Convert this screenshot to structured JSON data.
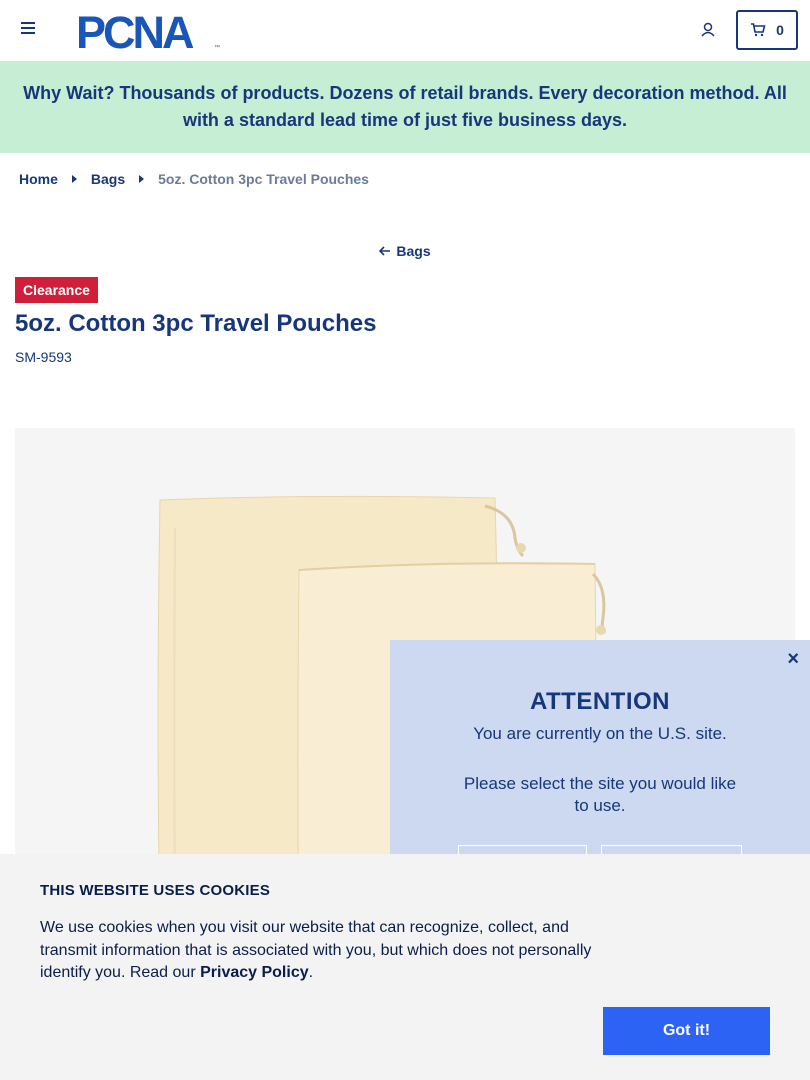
{
  "header": {
    "logo_text": "PCNA",
    "logo_mark": "™",
    "cart_count": "0"
  },
  "promo": {
    "text": "Why Wait? Thousands of products. Dozens of retail brands. Every decoration method. All with a standard lead time of just five business days."
  },
  "breadcrumb": [
    {
      "label": "Home"
    },
    {
      "label": "Bags"
    },
    {
      "label": "5oz. Cotton 3pc Travel Pouches"
    }
  ],
  "back_link": {
    "label": "Bags"
  },
  "product": {
    "badge": "Clearance",
    "title": "5oz. Cotton 3pc Travel Pouches",
    "sku": "SM-9593"
  },
  "attention": {
    "close": "×",
    "title": "ATTENTION",
    "line1": "You are currently on the U.S. site.",
    "line2": "Please select the site you would like to use."
  },
  "cookie": {
    "title": "THIS WEBSITE USES COOKIES",
    "body": "We use cookies when you visit our website that can recognize, collect, and transmit information that is associated with you, but which does not personally identify you. Read our ",
    "link": "Privacy Policy",
    "end": ".",
    "button": "Got it!"
  },
  "colors": {
    "brand_navy": "#17377a",
    "promo_bg": "#c6eed5",
    "badge_red": "#d01f3a",
    "modal_bg": "#ccd9f1",
    "cookie_button": "#2d63f5"
  },
  "icons": [
    "menu-icon",
    "user-icon",
    "cart-icon",
    "caret-right-icon",
    "arrow-left-icon",
    "close-icon"
  ]
}
